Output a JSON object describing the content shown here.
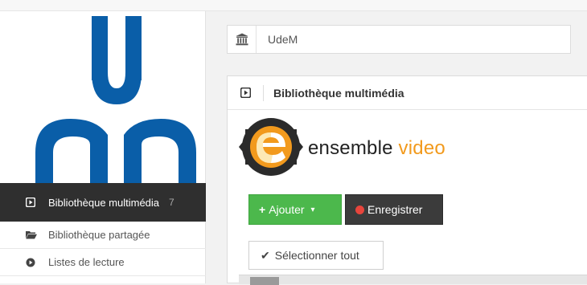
{
  "org": {
    "name": "UdeM",
    "icon": "institution-icon"
  },
  "sidebar": {
    "items": [
      {
        "label": "Bibliothèque multimédia",
        "count": "7",
        "icon": "play-square-icon",
        "active": true
      },
      {
        "label": "Bibliothèque partagée",
        "icon": "folder-open-icon"
      },
      {
        "label": "Listes de lecture",
        "icon": "circle-icon"
      }
    ]
  },
  "panel": {
    "title": "Bibliothèque multimédia",
    "brand": {
      "word1": "ensemble",
      "word2": "video"
    },
    "buttons": {
      "add": "Ajouter",
      "record": "Enregistrer",
      "select_all": "Sélectionner tout"
    }
  },
  "colors": {
    "udem_blue": "#0a5ea8",
    "add_green": "#4cb84c",
    "brand_orange": "#f29a1d",
    "dark": "#2f2f2f",
    "record_red": "#e8453c"
  }
}
